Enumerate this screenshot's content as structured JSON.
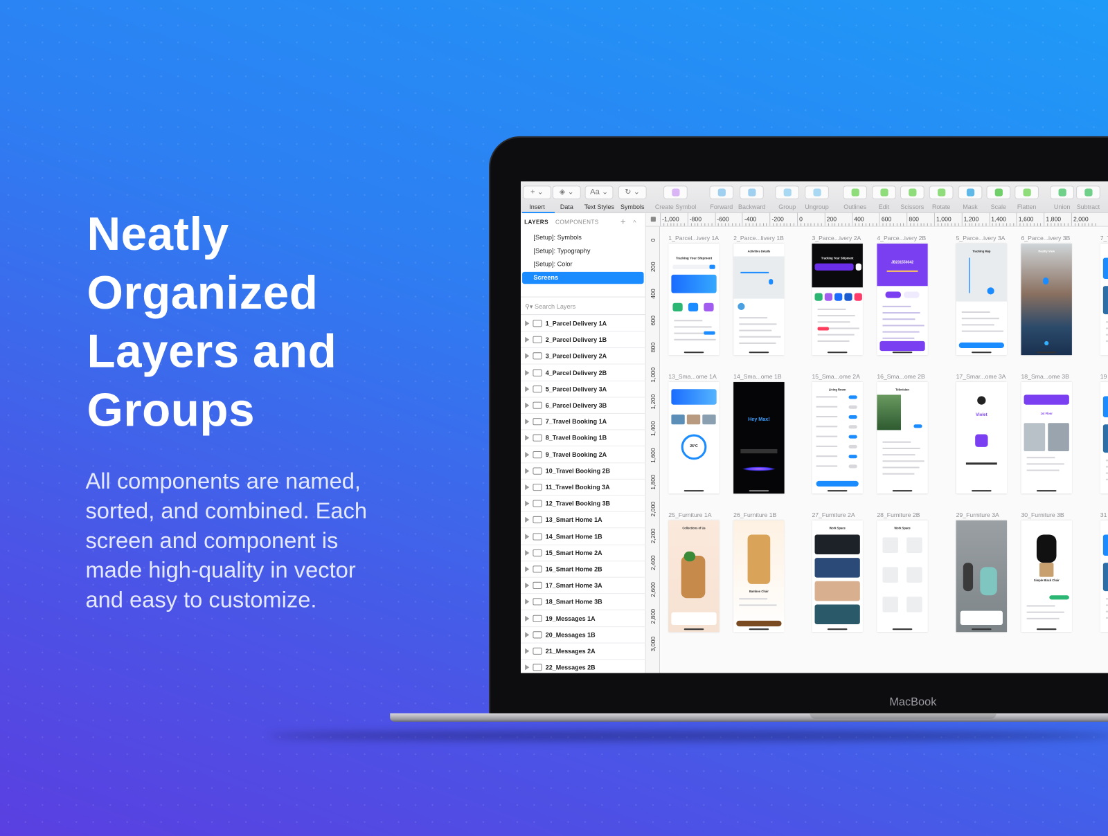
{
  "hero": {
    "title_lines": [
      "Neatly",
      "Organized",
      "Layers and",
      "Groups"
    ],
    "description": "All components are named, sorted, and combined. Each screen and component is made high-quality in vector and easy to customize."
  },
  "device": {
    "brand": "MacBook"
  },
  "colors": {
    "accent": "#1a8cff",
    "purple": "#7b3ff2",
    "bg_top": "#1f9af8",
    "bg_bottom": "#5a3fe0"
  },
  "toolbar": [
    {
      "label": "Insert",
      "icon": "plus-icon",
      "dropdown": true
    },
    {
      "label": "Data",
      "icon": "data-layers-icon",
      "dropdown": true
    },
    {
      "label": "Text Styles",
      "icon": "text-aa-icon",
      "dropdown": true
    },
    {
      "label": "Symbols",
      "icon": "symbols-icon",
      "dropdown": true
    },
    {
      "label": "Create Symbol",
      "icon": "create-symbol-icon"
    },
    {
      "label": "Forward",
      "icon": "forward-icon"
    },
    {
      "label": "Backward",
      "icon": "backward-icon"
    },
    {
      "label": "Group",
      "icon": "group-icon"
    },
    {
      "label": "Ungroup",
      "icon": "ungroup-icon"
    },
    {
      "label": "Outlines",
      "icon": "outlines-icon"
    },
    {
      "label": "Edit",
      "icon": "edit-icon"
    },
    {
      "label": "Scissors",
      "icon": "scissors-icon"
    },
    {
      "label": "Rotate",
      "icon": "rotate-icon"
    },
    {
      "label": "Mask",
      "icon": "mask-icon"
    },
    {
      "label": "Scale",
      "icon": "scale-icon"
    },
    {
      "label": "Flatten",
      "icon": "flatten-icon"
    },
    {
      "label": "Union",
      "icon": "union-icon"
    },
    {
      "label": "Subtract",
      "icon": "subtract-icon"
    }
  ],
  "panel": {
    "tab_layers": "LAYERS",
    "tab_components": "COMPONENTS",
    "add": "+",
    "collapse": "^",
    "pages": [
      "[Setup]: Symbols",
      "[Setup]: Typography",
      "[Setup]: Color"
    ],
    "selected_page": "Screens",
    "search_placeholder": "Search Layers",
    "layers": [
      "1_Parcel Delivery 1A",
      "2_Parcel Delivery 1B",
      "3_Parcel Delivery 2A",
      "4_Parcel Delivery 2B",
      "5_Parcel Delivery 3A",
      "6_Parcel Delivery 3B",
      "7_Travel Booking 1A",
      "8_Travel Booking 1B",
      "9_Travel Booking 2A",
      "10_Travel Booking 2B",
      "11_Travel Booking 3A",
      "12_Travel Booking 3B",
      "13_Smart Home 1A",
      "14_Smart Home 1B",
      "15_Smart Home 2A",
      "16_Smart Home 2B",
      "17_Smart Home 3A",
      "18_Smart Home 3B",
      "19_Messages 1A",
      "20_Messages 1B",
      "21_Messages 2A",
      "22_Messages 2B"
    ]
  },
  "rulers": {
    "horizontal": [
      "-1,000",
      "-800",
      "-600",
      "-400",
      "-200",
      "0",
      "200",
      "400",
      "600",
      "800",
      "1,000",
      "1,200",
      "1,400",
      "1,600",
      "1,800",
      "2,000"
    ],
    "vertical": [
      "0",
      "200",
      "400",
      "600",
      "800",
      "1,000",
      "1,200",
      "1,400",
      "1,600",
      "1,800",
      "2,000",
      "2,200",
      "2,400",
      "2,600",
      "2,800",
      "3,000"
    ]
  },
  "artboards": [
    [
      {
        "title": "1_Parcel...ivery 1A",
        "style": "light",
        "text": "Tracking Your Shipment"
      },
      {
        "title": "2_Parce...livery 1B",
        "style": "map",
        "text": "Activities Details"
      },
      {
        "title": "3_Parce...ivery 2A",
        "style": "dark",
        "text": "Tracking Your Shipment"
      },
      {
        "title": "4_Parce...ivery 2B",
        "style": "purple",
        "text": "JB231550342"
      },
      {
        "title": "5_Parce...ivery 3A",
        "style": "map2",
        "text": "Tracking Map"
      },
      {
        "title": "6_Parce...ivery 3B",
        "style": "city",
        "text": "Reality View"
      },
      {
        "title": "7_T",
        "style": "light2",
        "text": ""
      }
    ],
    [
      {
        "title": "13_Sma...ome 1A",
        "style": "home1",
        "text": "26°C"
      },
      {
        "title": "14_Sma...ome 1B",
        "style": "black",
        "text": "Hey Max!"
      },
      {
        "title": "15_Sma...ome 2A",
        "style": "list",
        "text": "Living Room"
      },
      {
        "title": "16_Sma...ome 2B",
        "style": "green",
        "text": "Television"
      },
      {
        "title": "17_Smar...ome 3A",
        "style": "violet",
        "text": "Violet"
      },
      {
        "title": "18_Sma...ome 3B",
        "style": "home3",
        "text": "1st Floor"
      },
      {
        "title": "19",
        "style": "light2",
        "text": ""
      }
    ],
    [
      {
        "title": "25_Furniture 1A",
        "style": "beige",
        "text": "Collections of Us"
      },
      {
        "title": "26_Furniture 1B",
        "style": "beige2",
        "text": "Bamboo Chair"
      },
      {
        "title": "27_Furniture 2A",
        "style": "cards",
        "text": "Work Space"
      },
      {
        "title": "28_Furniture 2B",
        "style": "grid",
        "text": "Work Space"
      },
      {
        "title": "29_Furniture 3A",
        "style": "grey",
        "text": ""
      },
      {
        "title": "30_Furniture 3B",
        "style": "chair",
        "text": "Simple Black Chair"
      },
      {
        "title": "31",
        "style": "light2",
        "text": ""
      }
    ]
  ]
}
